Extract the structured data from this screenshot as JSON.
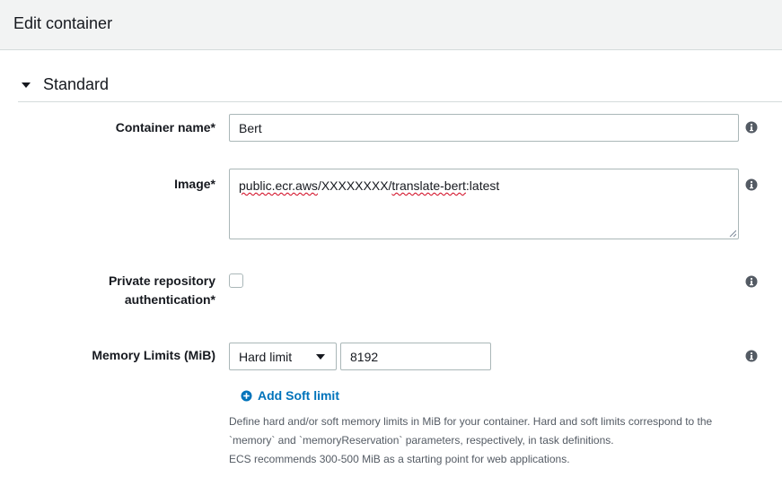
{
  "header": {
    "title": "Edit container"
  },
  "section": {
    "title": "Standard"
  },
  "fields": {
    "container_name": {
      "label": "Container name*",
      "value": "Bert"
    },
    "image": {
      "label": "Image*",
      "value_parts": [
        "public.ecr.aws",
        "/XXXXXXXX/",
        "translate-bert",
        ":latest"
      ]
    },
    "private_repo": {
      "label_line1": "Private repository",
      "label_line2": "authentication*",
      "checked": false
    },
    "memory": {
      "label": "Memory Limits (MiB)",
      "limit_type": "Hard limit",
      "value": "8192",
      "add_soft_limit": "Add Soft limit",
      "help_line1": "Define hard and/or soft memory limits in MiB for your container. Hard and soft limits correspond to the",
      "help_line2": "`memory` and `memoryReservation` parameters, respectively, in task definitions.",
      "help_line3": "ECS recommends 300-500 MiB as a starting point for web applications."
    }
  },
  "icons": {
    "info": "info-icon",
    "add": "plus-circle-icon",
    "caret": "caret-down-icon"
  },
  "colors": {
    "link": "#0073bb",
    "header_bg": "#f2f3f3",
    "border": "#aab7b8",
    "text": "#16191f"
  }
}
